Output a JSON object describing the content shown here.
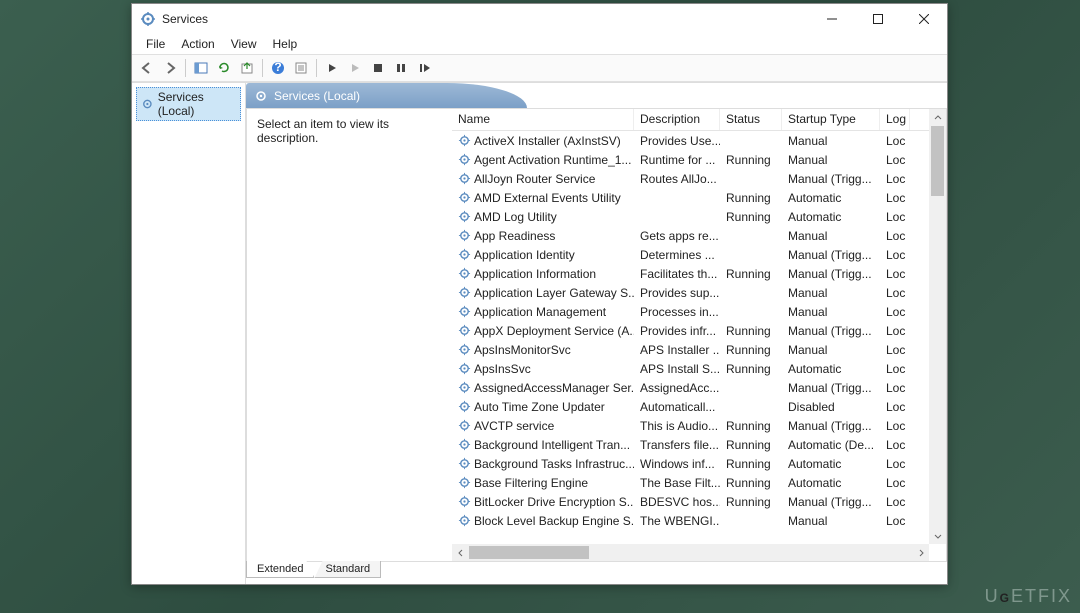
{
  "window": {
    "title": "Services"
  },
  "menu": {
    "file": "File",
    "action": "Action",
    "view": "View",
    "help": "Help"
  },
  "tree": {
    "root": "Services (Local)"
  },
  "header": {
    "title": "Services (Local)"
  },
  "desc_pane": {
    "text": "Select an item to view its description."
  },
  "columns": {
    "name": "Name",
    "description": "Description",
    "status": "Status",
    "startup": "Startup Type",
    "logon": "Log"
  },
  "services": [
    {
      "name": "ActiveX Installer (AxInstSV)",
      "desc": "Provides Use...",
      "status": "",
      "startup": "Manual",
      "log": "Loc"
    },
    {
      "name": "Agent Activation Runtime_1...",
      "desc": "Runtime for ...",
      "status": "Running",
      "startup": "Manual",
      "log": "Loc"
    },
    {
      "name": "AllJoyn Router Service",
      "desc": "Routes AllJo...",
      "status": "",
      "startup": "Manual (Trigg...",
      "log": "Loc"
    },
    {
      "name": "AMD External Events Utility",
      "desc": "",
      "status": "Running",
      "startup": "Automatic",
      "log": "Loc"
    },
    {
      "name": "AMD Log Utility",
      "desc": "",
      "status": "Running",
      "startup": "Automatic",
      "log": "Loc"
    },
    {
      "name": "App Readiness",
      "desc": "Gets apps re...",
      "status": "",
      "startup": "Manual",
      "log": "Loc"
    },
    {
      "name": "Application Identity",
      "desc": "Determines ...",
      "status": "",
      "startup": "Manual (Trigg...",
      "log": "Loc"
    },
    {
      "name": "Application Information",
      "desc": "Facilitates th...",
      "status": "Running",
      "startup": "Manual (Trigg...",
      "log": "Loc"
    },
    {
      "name": "Application Layer Gateway S...",
      "desc": "Provides sup...",
      "status": "",
      "startup": "Manual",
      "log": "Loc"
    },
    {
      "name": "Application Management",
      "desc": "Processes in...",
      "status": "",
      "startup": "Manual",
      "log": "Loc"
    },
    {
      "name": "AppX Deployment Service (A...",
      "desc": "Provides infr...",
      "status": "Running",
      "startup": "Manual (Trigg...",
      "log": "Loc"
    },
    {
      "name": "ApsInsMonitorSvc",
      "desc": "APS Installer ...",
      "status": "Running",
      "startup": "Manual",
      "log": "Loc"
    },
    {
      "name": "ApsInsSvc",
      "desc": "APS Install S...",
      "status": "Running",
      "startup": "Automatic",
      "log": "Loc"
    },
    {
      "name": "AssignedAccessManager Ser...",
      "desc": "AssignedAcc...",
      "status": "",
      "startup": "Manual (Trigg...",
      "log": "Loc"
    },
    {
      "name": "Auto Time Zone Updater",
      "desc": "Automaticall...",
      "status": "",
      "startup": "Disabled",
      "log": "Loc"
    },
    {
      "name": "AVCTP service",
      "desc": "This is Audio...",
      "status": "Running",
      "startup": "Manual (Trigg...",
      "log": "Loc"
    },
    {
      "name": "Background Intelligent Tran...",
      "desc": "Transfers file...",
      "status": "Running",
      "startup": "Automatic (De...",
      "log": "Loc"
    },
    {
      "name": "Background Tasks Infrastruc...",
      "desc": "Windows inf...",
      "status": "Running",
      "startup": "Automatic",
      "log": "Loc"
    },
    {
      "name": "Base Filtering Engine",
      "desc": "The Base Filt...",
      "status": "Running",
      "startup": "Automatic",
      "log": "Loc"
    },
    {
      "name": "BitLocker Drive Encryption S...",
      "desc": "BDESVC hos...",
      "status": "Running",
      "startup": "Manual (Trigg...",
      "log": "Loc"
    },
    {
      "name": "Block Level Backup Engine S...",
      "desc": "The WBENGI...",
      "status": "",
      "startup": "Manual",
      "log": "Loc"
    }
  ],
  "tabs": {
    "extended": "Extended",
    "standard": "Standard"
  },
  "watermark": "UGETFIX"
}
